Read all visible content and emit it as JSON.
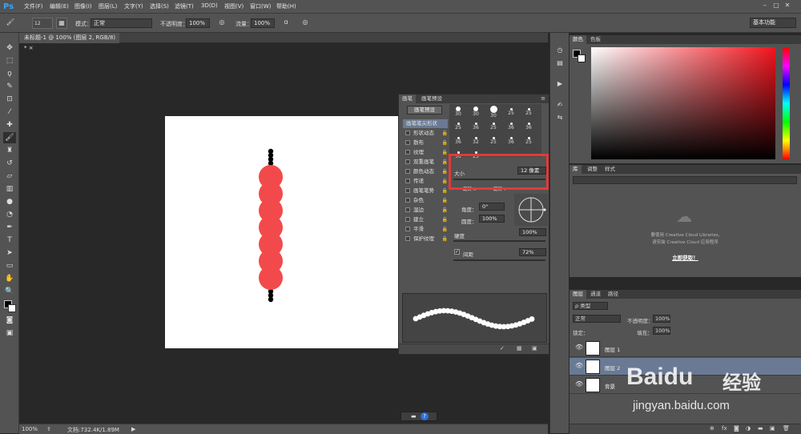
{
  "app": {
    "logo": "Ps",
    "menus": [
      "文件(F)",
      "编辑(E)",
      "图像(I)",
      "图层(L)",
      "文字(Y)",
      "选择(S)",
      "滤镜(T)",
      "3D(D)",
      "视图(V)",
      "窗口(W)",
      "帮助(H)"
    ],
    "window_controls": [
      "–",
      "▢",
      "✕"
    ]
  },
  "options": {
    "brush_size": "12",
    "mode_label": "模式：",
    "mode_value": "正常",
    "opacity_label": "不透明度：",
    "opacity_value": "100%",
    "flow_label": "流量：",
    "flow_value": "100%",
    "workspace": "基本功能"
  },
  "document": {
    "tab_title": "未标题-1 @ 100% (图层 2, RGB/8) *",
    "close": "×"
  },
  "status": {
    "zoom": "100%",
    "doc_info": "文档:732.4K/1.89M"
  },
  "brush_panel": {
    "tabs": [
      "画笔",
      "画笔预设"
    ],
    "preset_button": "画笔预设",
    "options": [
      {
        "label": "画笔笔尖形状",
        "active": true
      },
      {
        "label": "形状动态"
      },
      {
        "label": "散布"
      },
      {
        "label": "纹理"
      },
      {
        "label": "双重画笔"
      },
      {
        "label": "颜色动态"
      },
      {
        "label": "传递"
      },
      {
        "label": "画笔笔势"
      },
      {
        "label": "杂色"
      },
      {
        "label": "湿边"
      },
      {
        "label": "建立"
      },
      {
        "label": "平滑"
      },
      {
        "label": "保护纹理"
      }
    ],
    "tip_sizes": [
      "30",
      "30",
      "30",
      "25",
      "25",
      "25",
      "36",
      "25",
      "36",
      "36",
      "36",
      "32",
      "25",
      "36",
      "25",
      "50",
      "25"
    ],
    "size_label": "大小",
    "size_value": "12 像素",
    "flip_x": "翻转 X",
    "flip_y": "翻转 Y",
    "angle_label": "角度：",
    "angle_value": "0°",
    "roundness_label": "圆度：",
    "roundness_value": "100%",
    "hardness_label": "硬度",
    "hardness_value": "100%",
    "spacing_label": "间距",
    "spacing_value": "72%"
  },
  "color_panel": {
    "tabs": [
      "颜色",
      "色板"
    ],
    "accent": "#f2141e"
  },
  "libraries_panel": {
    "tabs": [
      "库",
      "调整",
      "样式"
    ],
    "message_line1": "要使用 Creative Cloud Libraries,",
    "message_line2": "请安装 Creative Cloud 应用程序",
    "link": "立即获取！"
  },
  "layers_panel": {
    "tabs": [
      "图层",
      "通道",
      "路径"
    ],
    "filter": "ρ 类型",
    "blend": "正常",
    "opacity_label": "不透明度：",
    "opacity_value": "100%",
    "lock_label": "锁定：",
    "fill_label": "填充：",
    "fill_value": "100%",
    "layers": [
      {
        "name": "图层 1",
        "selected": false
      },
      {
        "name": "图层 2",
        "selected": true
      },
      {
        "name": "背景",
        "selected": false
      }
    ]
  },
  "watermark": {
    "brand": "Baidu",
    "brand_cn": "经验",
    "url": "jingyan.baidu.com"
  },
  "colors": {
    "panel": "#535353",
    "dark": "#282828",
    "highlight": "#e23a3a",
    "brush_red": "#f24a4a",
    "selection": "#6a7a94"
  }
}
